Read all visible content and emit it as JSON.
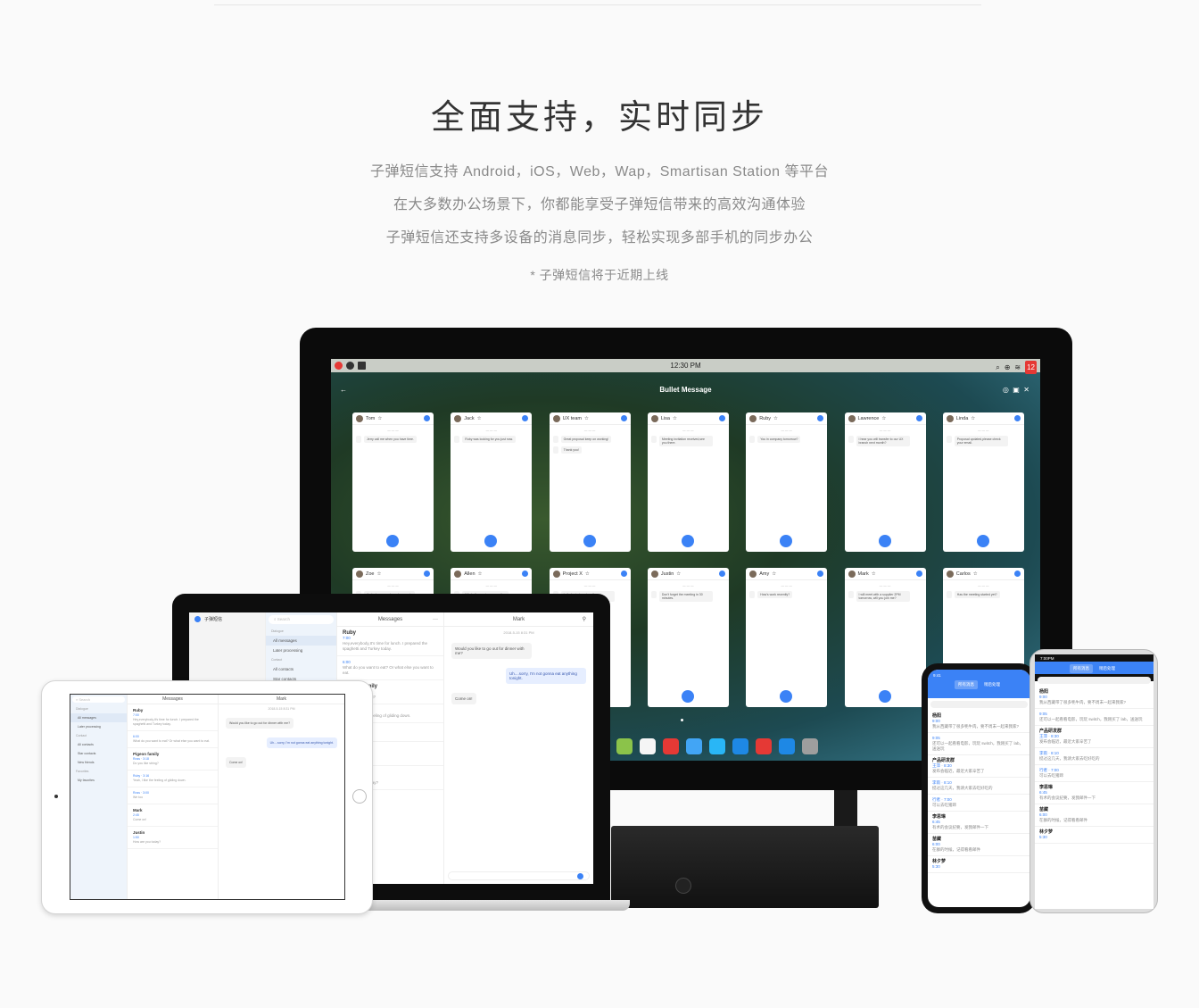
{
  "header": {
    "title": "全面支持，实时同步",
    "lines": [
      "子弹短信支持 Android，iOS，Web，Wap，Smartisan Station 等平台",
      "在大多数办公场景下，你都能享受子弹短信带来的高效沟通体验",
      "子弹短信还支持多设备的消息同步，轻松实现多部手机的同步办公"
    ],
    "note": "* 子弹短信将于近期上线"
  },
  "monitor": {
    "time": "12:30 PM",
    "notif_count": "12",
    "app_title": "Bullet Message",
    "cards": [
      {
        "name": "Tom",
        "msgs": [
          "Jerry call me when you have time."
        ]
      },
      {
        "name": "Jack",
        "msgs": [
          "Ruby was looking for you just now."
        ]
      },
      {
        "name": "UX team",
        "msgs": [
          "Great proposal keep on working!",
          "Thank you!"
        ]
      },
      {
        "name": "Lisa",
        "msgs": [
          "Meeting invitation received,see you there."
        ]
      },
      {
        "name": "Ruby",
        "msgs": [
          "You in company tomorrow?"
        ]
      },
      {
        "name": "Lawrence",
        "msgs": [
          "I hear you will transfer to our UX branch next month?"
        ]
      },
      {
        "name": "Linda",
        "msgs": [
          "Proposal updated,please check your email."
        ]
      },
      {
        "name": "Zoe",
        "msgs": [
          "Jack please send me documents"
        ]
      },
      {
        "name": "Allen",
        "msgs": [
          "Who's the guy in our meeting"
        ]
      },
      {
        "name": "Project X",
        "msgs": [
          "Let's brainstorm together tomorrow"
        ]
      },
      {
        "name": "Justin",
        "msgs": [
          "Don't forget the meeting in 30 minutes."
        ]
      },
      {
        "name": "Amy",
        "msgs": [
          "How's work recently?"
        ]
      },
      {
        "name": "Mark",
        "msgs": [
          "I will meet with a supplier 2PM tomorrow, will you join me?"
        ]
      },
      {
        "name": "Carlos",
        "msgs": [
          "Has the meeting started yet?"
        ]
      }
    ],
    "dock_colors": [
      "#8bc34a",
      "#f5f5f5",
      "#e53935",
      "#42a5f5",
      "#29b6f6",
      "#1e88e5",
      "#e53935",
      "#1e88e5",
      "#9e9e9e"
    ]
  },
  "laptop": {
    "app_name": "子弹短信",
    "search": "Search",
    "nav": [
      {
        "section": "Dialogue",
        "items": [
          "All messages",
          "Later processing"
        ]
      },
      {
        "section": "Contact",
        "items": [
          "All contacts",
          "Star contacts",
          "New friends"
        ]
      },
      {
        "section": "Favorites",
        "items": [
          "My favorites"
        ]
      }
    ],
    "list_title": "Messages",
    "more": "···",
    "list": [
      {
        "name": "Ruby",
        "time": "7:00",
        "text": "Hey,everybody,It's time for lunch. I prepared the spaghetti and Turkey today."
      },
      {
        "name": "",
        "time": "6:00",
        "text": "What do you want to eat? Or what else you want to eat."
      },
      {
        "name": "Pigeon family",
        "time": "Ross · 3:18",
        "text": "Do you like string?"
      },
      {
        "name": "",
        "time": "Ruby · 3:16",
        "text": "Yeah, I like the feeling of gliding down."
      },
      {
        "name": "",
        "time": "Ross · 3:00",
        "text": "We too"
      },
      {
        "name": "Mark",
        "time": "2:45",
        "text": "Come on!"
      },
      {
        "name": "Justin",
        "time": "1:50",
        "text": "How are you today?"
      }
    ],
    "chat_title": "Mark",
    "chat_time": "2018-5-15 8:31 PM",
    "chat": [
      {
        "dir": "in",
        "text": "Would you like to go out for dinner with me?"
      },
      {
        "dir": "out",
        "text": "Uh....sorry,  I'm not gonna eat anything tonight."
      },
      {
        "dir": "in",
        "text": "Come on!"
      }
    ]
  },
  "phones": {
    "time_a": "9:41",
    "time_b": "7:00PM",
    "tabs": [
      "所有消息",
      "稍后处理"
    ],
    "list": [
      {
        "name": "杨阳",
        "time": "9:00",
        "text": "我从西藏带了很多牦牛肉，要不周末一起来我家?"
      },
      {
        "name": "",
        "time": "9:05",
        "text": "还可以一起看看电影，玩玩 switch，我刚买了 lab，送送玩"
      },
      {
        "name": "产品研发群",
        "time": "王萍 · 8:30",
        "text": "发布会临近，最近大家辛苦了"
      },
      {
        "name": "",
        "time": "李雨 · 8:10",
        "text": "挺过这几天，我请大家去吃好吃的"
      },
      {
        "name": "",
        "time": "行者 · 7:00",
        "text": "可以去吃猪蹄"
      },
      {
        "name": "李思琳",
        "time": "6:45",
        "text": "有术的会议纪要，发我邮件一下"
      },
      {
        "name": "苗藏",
        "time": "6:00",
        "text": "在群的时候，记得看看邮件"
      },
      {
        "name": "林夕梦",
        "time": "5:30",
        "text": ""
      }
    ]
  }
}
